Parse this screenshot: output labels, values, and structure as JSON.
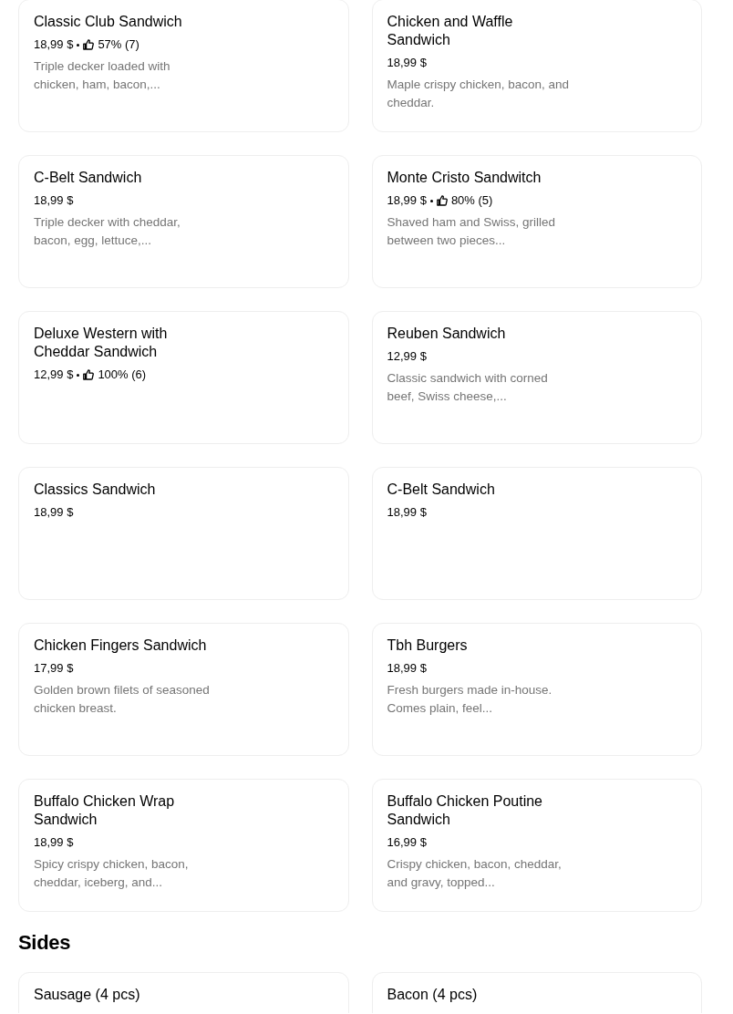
{
  "sections": [
    {
      "items": [
        {
          "title": "Classic Club Sandwich",
          "price": "18,99 $",
          "rating": "57% (7)",
          "description": "Triple decker loaded with chicken, ham, bacon,..."
        },
        {
          "title": "Chicken and Waffle Sandwich",
          "price": "18,99 $",
          "description": "Maple crispy chicken, bacon, and cheddar."
        },
        {
          "title": "C-Belt Sandwich",
          "price": "18,99 $",
          "description": "Triple decker with cheddar, bacon, egg, lettuce,..."
        },
        {
          "title": "Monte Cristo Sandwitch",
          "price": "18,99 $",
          "rating": "80% (5)",
          "description": "Shaved ham and Swiss, grilled between two pieces..."
        },
        {
          "title": "Deluxe Western with Cheddar Sandwich",
          "price": "12,99 $",
          "rating": "100% (6)"
        },
        {
          "title": "Reuben Sandwich",
          "price": "12,99 $",
          "description": "Classic sandwich with corned beef, Swiss cheese,..."
        },
        {
          "title": "Classics Sandwich",
          "price": "18,99 $"
        },
        {
          "title": "C-Belt Sandwich",
          "price": "18,99 $"
        },
        {
          "title": "Chicken Fingers Sandwich",
          "price": "17,99 $",
          "description": "Golden brown filets of seasoned chicken breast."
        },
        {
          "title": "Tbh Burgers",
          "price": "18,99 $",
          "description": "Fresh burgers made in-house. Comes plain, feel..."
        },
        {
          "title": "Buffalo Chicken Wrap Sandwich",
          "price": "18,99 $",
          "description": "Spicy crispy chicken, bacon, cheddar, iceberg, and..."
        },
        {
          "title": "Buffalo Chicken Poutine Sandwich",
          "price": "16,99 $",
          "description": "Crispy chicken, bacon, cheddar, and gravy, topped..."
        }
      ]
    },
    {
      "heading": "Sides",
      "items": [
        {
          "title": "Sausage (4 pcs)"
        },
        {
          "title": "Bacon (4 pcs)"
        }
      ]
    }
  ]
}
